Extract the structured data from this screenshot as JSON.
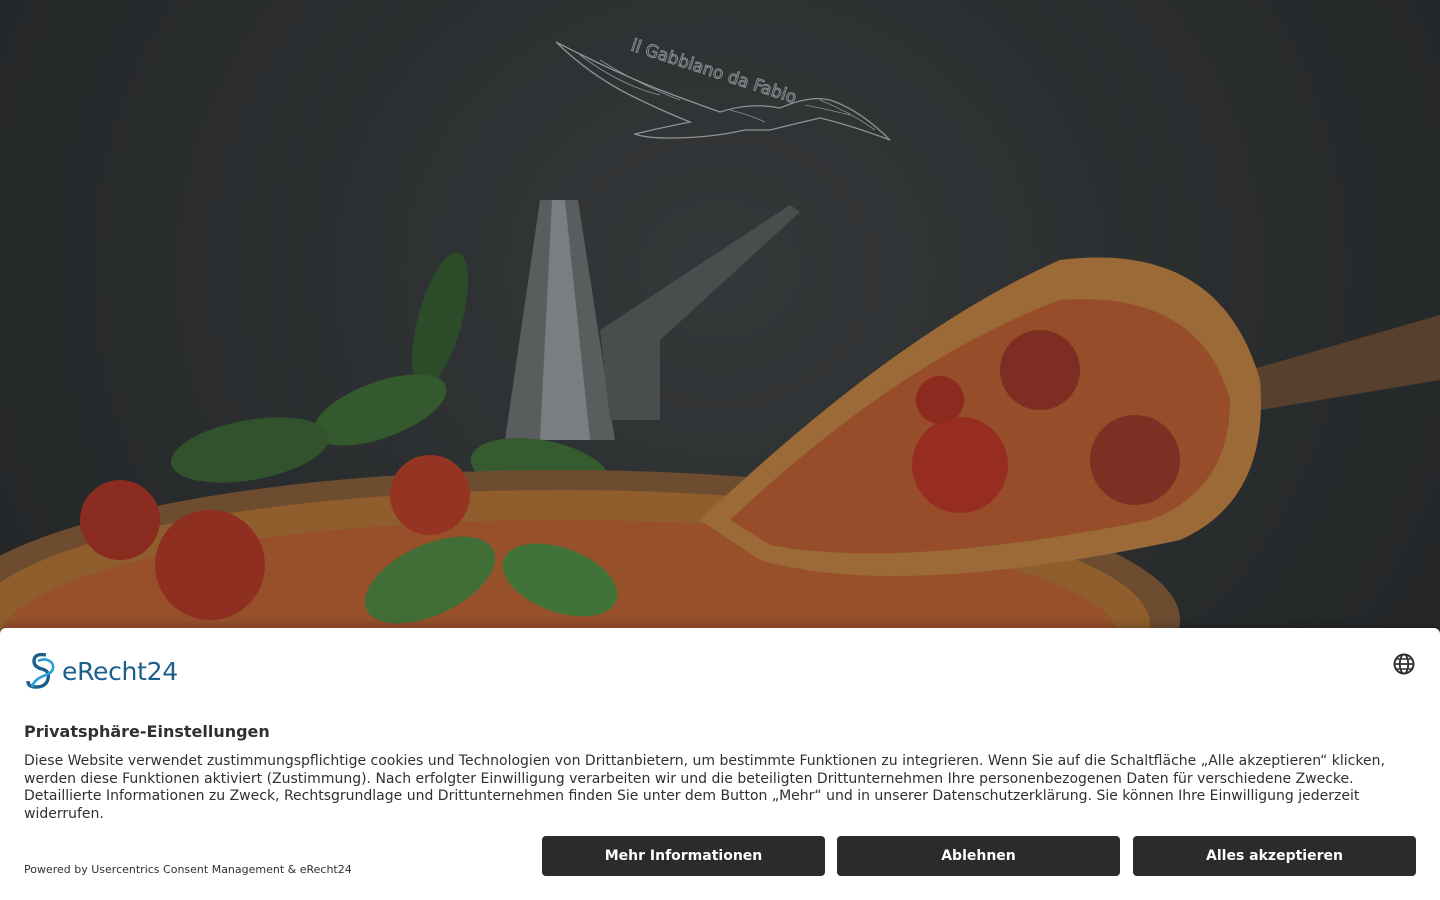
{
  "logo": {
    "text": "il Gabbiano da Fabio"
  },
  "consent": {
    "brand_name": "eRecht24",
    "title": "Privatsphäre-Einstellungen",
    "description": "Diese Website verwendet zustimmungspflichtige cookies und Technologien von Drittanbietern, um bestimmte Funktionen zu integrieren. Wenn Sie auf die Schaltfläche „Alle akzeptieren“ klicken, werden diese Funktionen aktiviert (Zustimmung). Nach erfolgter Einwilligung verarbeiten wir und die beteiligten Drittunternehmen Ihre personenbezogenen Daten für verschiedene Zwecke. Detaillierte Informationen zu Zweck, Rechtsgrundlage und Drittunternehmen finden Sie unter dem Button „Mehr“ und in unserer Datenschutzerklärung. Sie können Ihre Einwilligung jederzeit widerrufen.",
    "powered_by": "Powered by Usercentrics Consent Management & eRecht24",
    "buttons": {
      "more": "Mehr Informationen",
      "deny": "Ablehnen",
      "accept": "Alles akzeptieren"
    },
    "icons": {
      "language": "globe-icon",
      "brand": "erecht24-logo-icon"
    },
    "colors": {
      "brand": "#1b5f8c",
      "button_bg": "#2b2b2b",
      "button_text": "#ffffff"
    }
  }
}
